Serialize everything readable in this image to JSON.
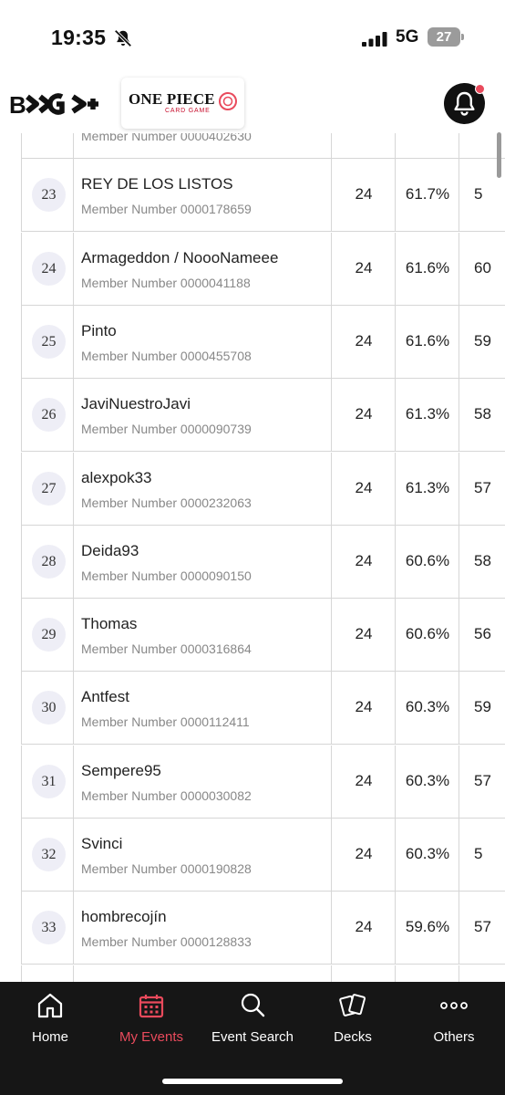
{
  "status_bar": {
    "time": "19:35",
    "network": "5G",
    "battery": "27",
    "icons": [
      "bell-slash-icon",
      "signal-bars-icon",
      "battery-icon"
    ]
  },
  "header": {
    "brand_logo": "B-CG+",
    "card_logo_title": "ONE PIECE",
    "card_logo_subtitle": "CARD GAME",
    "notification_icon": "bell-icon",
    "notification_dot_color": "#e94a5c"
  },
  "table": {
    "rows": [
      {
        "rank": "",
        "name": "",
        "member": "Member Number 0000402630",
        "points": "",
        "pct": "",
        "extra": ""
      },
      {
        "rank": "23",
        "name": "REY DE LOS LISTOS",
        "member": "Member Number 0000178659",
        "points": "24",
        "pct": "61.7%",
        "extra": "5"
      },
      {
        "rank": "24",
        "name": "Armageddon / NoooNameee",
        "member": "Member Number 0000041188",
        "points": "24",
        "pct": "61.6%",
        "extra": "60"
      },
      {
        "rank": "25",
        "name": "Pinto",
        "member": "Member Number 0000455708",
        "points": "24",
        "pct": "61.6%",
        "extra": "59"
      },
      {
        "rank": "26",
        "name": "JaviNuestroJavi",
        "member": "Member Number 0000090739",
        "points": "24",
        "pct": "61.3%",
        "extra": "58"
      },
      {
        "rank": "27",
        "name": "alexpok33",
        "member": "Member Number 0000232063",
        "points": "24",
        "pct": "61.3%",
        "extra": "57"
      },
      {
        "rank": "28",
        "name": "Deida93",
        "member": "Member Number 0000090150",
        "points": "24",
        "pct": "60.6%",
        "extra": "58"
      },
      {
        "rank": "29",
        "name": "Thomas",
        "member": "Member Number 0000316864",
        "points": "24",
        "pct": "60.6%",
        "extra": "56"
      },
      {
        "rank": "30",
        "name": "Antfest",
        "member": "Member Number 0000112411",
        "points": "24",
        "pct": "60.3%",
        "extra": "59"
      },
      {
        "rank": "31",
        "name": "Sempere95",
        "member": "Member Number 0000030082",
        "points": "24",
        "pct": "60.3%",
        "extra": "57"
      },
      {
        "rank": "32",
        "name": "Svinci",
        "member": "Member Number 0000190828",
        "points": "24",
        "pct": "60.3%",
        "extra": "5"
      },
      {
        "rank": "33",
        "name": "hombrecojín",
        "member": "Member Number 0000128833",
        "points": "24",
        "pct": "59.6%",
        "extra": "57"
      },
      {
        "rank": "",
        "name": "",
        "member": "",
        "points": "",
        "pct": "",
        "extra": ""
      }
    ]
  },
  "tab_bar": {
    "active_color": "#e94a5c",
    "tabs": [
      {
        "label": "Home",
        "icon": "home-icon"
      },
      {
        "label": "My Events",
        "icon": "calendar-icon"
      },
      {
        "label": "Event Search",
        "icon": "search-icon"
      },
      {
        "label": "Decks",
        "icon": "cards-icon"
      },
      {
        "label": "Others",
        "icon": "more-dots-icon"
      }
    ]
  }
}
